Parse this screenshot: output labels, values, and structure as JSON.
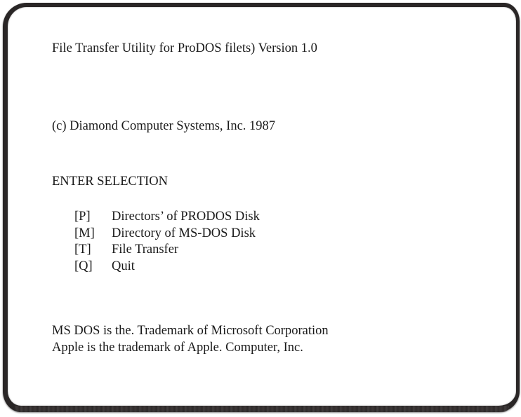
{
  "screen": {
    "title": "File Transfer Utility for ProDOS filets) Version 1.0",
    "copyright": "(c) Diamond Computer Systems, Inc. 1987",
    "prompt": "ENTER SELECTION",
    "menu": [
      {
        "key": "[P]",
        "label": "Directors’ of PRODOS Disk"
      },
      {
        "key": "[M]",
        "label": "Directory of MS-DOS Disk"
      },
      {
        "key": "[T]",
        "label": "File Transfer"
      },
      {
        "key": "[Q]",
        "label": "Quit"
      }
    ],
    "trademarks": [
      "MS DOS is the. Trademark of Microsoft Corporation",
      "Apple is the trademark of Apple. Computer, Inc."
    ]
  },
  "colors": {
    "background": "#ffffff",
    "text": "#1a1a1a",
    "bezel": "#2a2626"
  }
}
